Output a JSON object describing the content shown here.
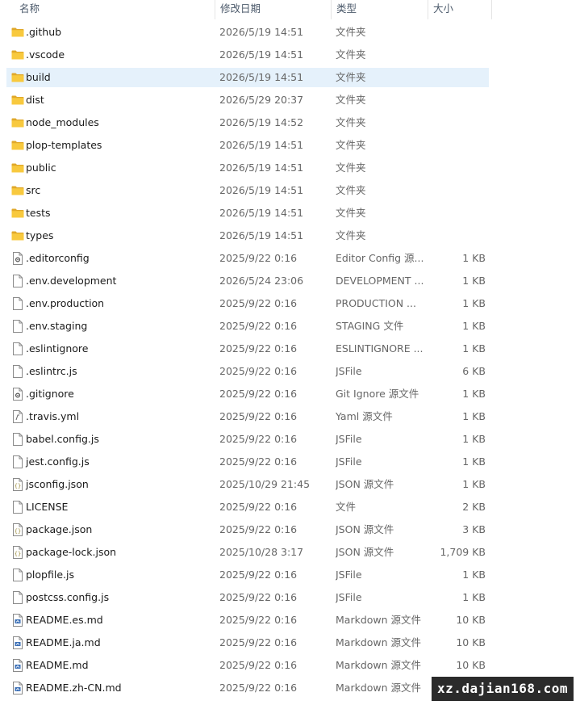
{
  "columns": {
    "name": "名称",
    "date": "修改日期",
    "type": "类型",
    "size": "大小"
  },
  "selected_index": 2,
  "files": [
    {
      "name": ".github",
      "date": "2026/5/19 14:51",
      "type": "文件夹",
      "size": "",
      "icon": "folder-icon"
    },
    {
      "name": ".vscode",
      "date": "2026/5/19 14:51",
      "type": "文件夹",
      "size": "",
      "icon": "folder-icon"
    },
    {
      "name": "build",
      "date": "2026/5/19 14:51",
      "type": "文件夹",
      "size": "",
      "icon": "folder-icon"
    },
    {
      "name": "dist",
      "date": "2026/5/29 20:37",
      "type": "文件夹",
      "size": "",
      "icon": "folder-icon"
    },
    {
      "name": "node_modules",
      "date": "2026/5/19 14:52",
      "type": "文件夹",
      "size": "",
      "icon": "folder-icon"
    },
    {
      "name": "plop-templates",
      "date": "2026/5/19 14:51",
      "type": "文件夹",
      "size": "",
      "icon": "folder-icon"
    },
    {
      "name": "public",
      "date": "2026/5/19 14:51",
      "type": "文件夹",
      "size": "",
      "icon": "folder-icon"
    },
    {
      "name": "src",
      "date": "2026/5/19 14:51",
      "type": "文件夹",
      "size": "",
      "icon": "folder-icon"
    },
    {
      "name": "tests",
      "date": "2026/5/19 14:51",
      "type": "文件夹",
      "size": "",
      "icon": "folder-icon"
    },
    {
      "name": "types",
      "date": "2026/5/19 14:51",
      "type": "文件夹",
      "size": "",
      "icon": "folder-icon"
    },
    {
      "name": ".editorconfig",
      "date": "2025/9/22 0:16",
      "type": "Editor Config 源...",
      "size": "1 KB",
      "icon": "config-file-icon"
    },
    {
      "name": ".env.development",
      "date": "2026/5/24 23:06",
      "type": "DEVELOPMENT ...",
      "size": "1 KB",
      "icon": "file-icon"
    },
    {
      "name": ".env.production",
      "date": "2025/9/22 0:16",
      "type": "PRODUCTION ...",
      "size": "1 KB",
      "icon": "file-icon"
    },
    {
      "name": ".env.staging",
      "date": "2025/9/22 0:16",
      "type": "STAGING 文件",
      "size": "1 KB",
      "icon": "file-icon"
    },
    {
      "name": ".eslintignore",
      "date": "2025/9/22 0:16",
      "type": "ESLINTIGNORE ...",
      "size": "1 KB",
      "icon": "file-icon"
    },
    {
      "name": ".eslintrc.js",
      "date": "2025/9/22 0:16",
      "type": "JSFile",
      "size": "6 KB",
      "icon": "js-file-icon"
    },
    {
      "name": ".gitignore",
      "date": "2025/9/22 0:16",
      "type": "Git Ignore 源文件",
      "size": "1 KB",
      "icon": "config-file-icon"
    },
    {
      "name": ".travis.yml",
      "date": "2025/9/22 0:16",
      "type": "Yaml 源文件",
      "size": "1 KB",
      "icon": "yaml-file-icon"
    },
    {
      "name": "babel.config.js",
      "date": "2025/9/22 0:16",
      "type": "JSFile",
      "size": "1 KB",
      "icon": "js-file-icon"
    },
    {
      "name": "jest.config.js",
      "date": "2025/9/22 0:16",
      "type": "JSFile",
      "size": "1 KB",
      "icon": "js-file-icon"
    },
    {
      "name": "jsconfig.json",
      "date": "2025/10/29 21:45",
      "type": "JSON 源文件",
      "size": "1 KB",
      "icon": "json-file-icon"
    },
    {
      "name": "LICENSE",
      "date": "2025/9/22 0:16",
      "type": "文件",
      "size": "2 KB",
      "icon": "file-icon"
    },
    {
      "name": "package.json",
      "date": "2025/9/22 0:16",
      "type": "JSON 源文件",
      "size": "3 KB",
      "icon": "json-file-icon"
    },
    {
      "name": "package-lock.json",
      "date": "2025/10/28 3:17",
      "type": "JSON 源文件",
      "size": "1,709 KB",
      "icon": "json-file-icon"
    },
    {
      "name": "plopfile.js",
      "date": "2025/9/22 0:16",
      "type": "JSFile",
      "size": "1 KB",
      "icon": "js-file-icon"
    },
    {
      "name": "postcss.config.js",
      "date": "2025/9/22 0:16",
      "type": "JSFile",
      "size": "1 KB",
      "icon": "js-file-icon"
    },
    {
      "name": "README.es.md",
      "date": "2025/9/22 0:16",
      "type": "Markdown 源文件",
      "size": "10 KB",
      "icon": "markdown-file-icon"
    },
    {
      "name": "README.ja.md",
      "date": "2025/9/22 0:16",
      "type": "Markdown 源文件",
      "size": "10 KB",
      "icon": "markdown-file-icon"
    },
    {
      "name": "README.md",
      "date": "2025/9/22 0:16",
      "type": "Markdown 源文件",
      "size": "10 KB",
      "icon": "markdown-file-icon"
    },
    {
      "name": "README.zh-CN.md",
      "date": "2025/9/22 0:16",
      "type": "Markdown 源文件",
      "size": "",
      "icon": "markdown-file-icon"
    }
  ],
  "watermark": "xz.dajian168.com",
  "colors": {
    "folder": "#f8c93e",
    "folder_dark": "#e0a82a",
    "selected_row": "#e5f1fb",
    "markdown_badge": "#3b6fb6"
  }
}
